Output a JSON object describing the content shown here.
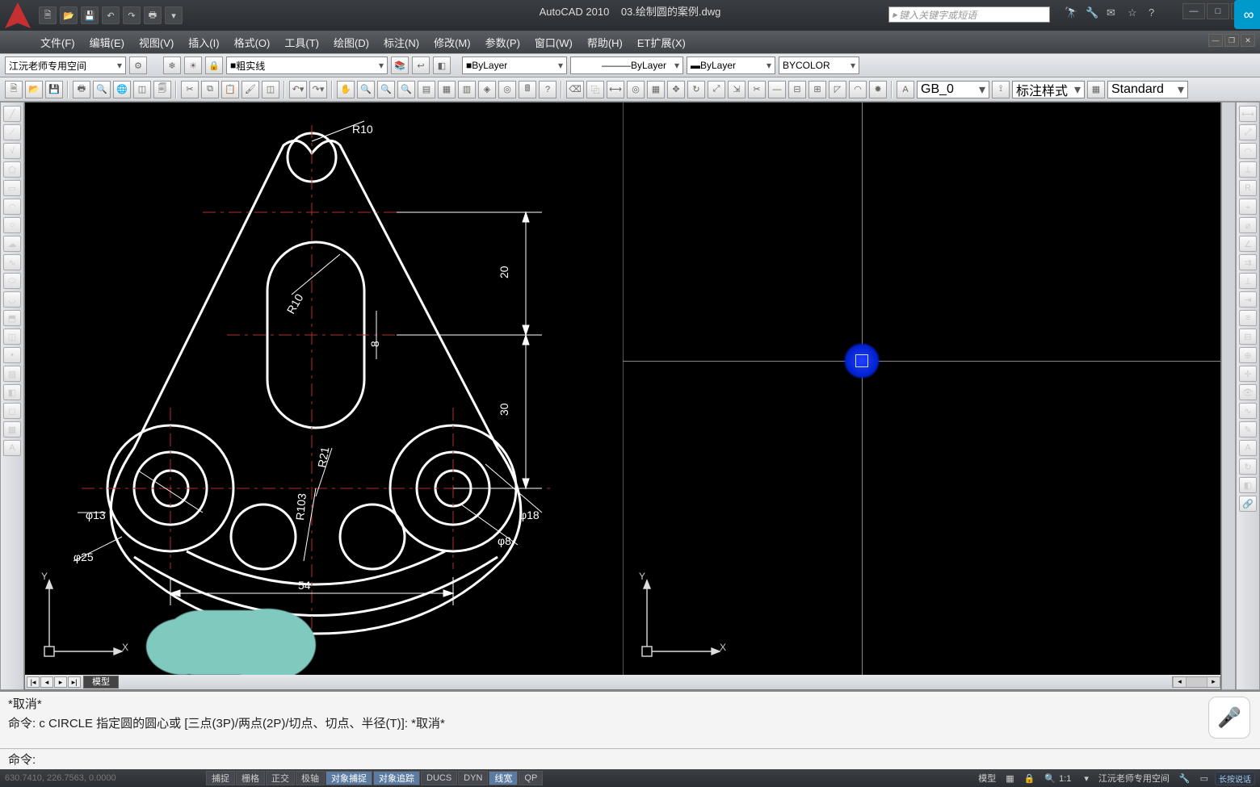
{
  "app": {
    "name": "AutoCAD 2010",
    "doc": "03.绘制圆的案例.dwg",
    "search_ph": "键入关键字或短语"
  },
  "menu": [
    "文件(F)",
    "编辑(E)",
    "视图(V)",
    "插入(I)",
    "格式(O)",
    "工具(T)",
    "绘图(D)",
    "标注(N)",
    "修改(M)",
    "参数(P)",
    "窗口(W)",
    "帮助(H)",
    "ET扩展(X)"
  ],
  "layerrow": {
    "workspace": "江沅老师专用空间",
    "linetype_layer": "粗实线",
    "color": "ByLayer",
    "ltype": "ByLayer",
    "lweight": "ByLayer",
    "plot": "BYCOLOR"
  },
  "text": {
    "style": "GB_0",
    "dimstyle": "标注样式",
    "tablestyle": "Standard"
  },
  "tabs": {
    "model": "模型"
  },
  "cmd": {
    "l1": "*取消*",
    "l2": "命令: c CIRCLE 指定圆的圆心或 [三点(3P)/两点(2P)/切点、切点、半径(T)]: *取消*",
    "prompt": "命令:"
  },
  "status": {
    "coord": "630.7410, 226.7563, 0.0000",
    "toggles": [
      {
        "t": "捕捉",
        "on": false
      },
      {
        "t": "栅格",
        "on": false
      },
      {
        "t": "正交",
        "on": false
      },
      {
        "t": "极轴",
        "on": false
      },
      {
        "t": "对象捕捉",
        "on": true
      },
      {
        "t": "对象追踪",
        "on": true
      },
      {
        "t": "DUCS",
        "on": false
      },
      {
        "t": "DYN",
        "on": false
      },
      {
        "t": "线宽",
        "on": true
      },
      {
        "t": "QP",
        "on": false
      }
    ],
    "right": {
      "modelspace": "模型",
      "scale": "1:1",
      "ws": "江沅老师专用空间",
      "voice": "长按说话"
    }
  },
  "dims": {
    "R10": "R10",
    "R10b": "R10",
    "d8": "8",
    "d20": "20",
    "d30": "30",
    "d54": "54",
    "R21": "R21",
    "R103": "R103",
    "p13": "φ13",
    "p25": "φ25",
    "p18": "φ18",
    "p8": "φ8",
    "X": "X",
    "Y": "Y"
  }
}
